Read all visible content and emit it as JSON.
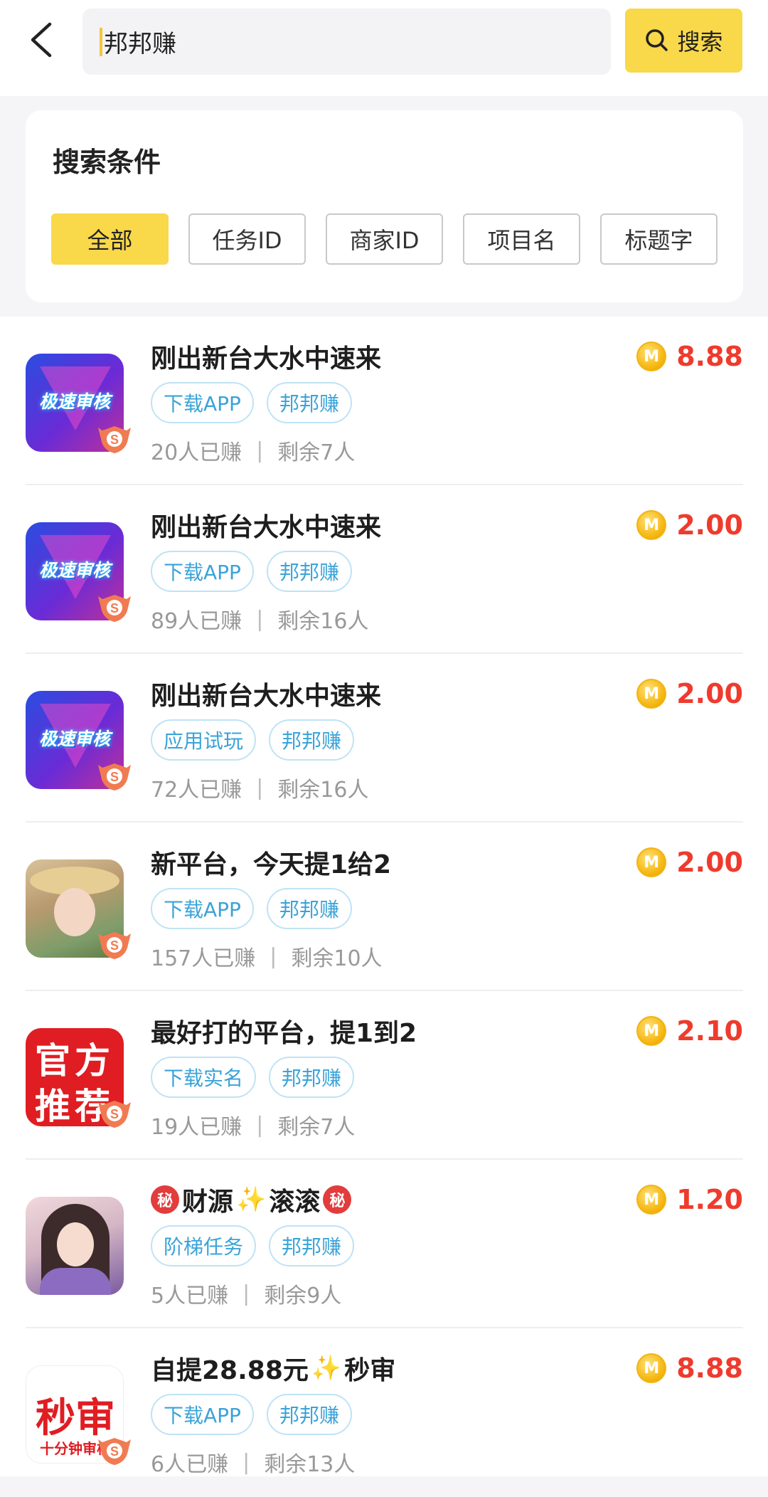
{
  "header": {
    "search_value": "邦邦赚",
    "search_button_label": "搜索"
  },
  "filter": {
    "title": "搜索条件",
    "chips": [
      {
        "label": "全部",
        "active": true
      },
      {
        "label": "任务ID",
        "active": false
      },
      {
        "label": "商家ID",
        "active": false
      },
      {
        "label": "项目名",
        "active": false
      },
      {
        "label": "标题字",
        "active": false
      }
    ]
  },
  "tasks": [
    {
      "thumb": "app-logo-jisu",
      "thumb_text": "极速审核",
      "title": "刚出新台大水中速来",
      "tags": [
        "下载APP",
        "邦邦赚"
      ],
      "earned": "20人已赚",
      "remaining": "剩余7人",
      "price": "8.88"
    },
    {
      "thumb": "app-logo-jisu",
      "thumb_text": "极速审核",
      "title": "刚出新台大水中速来",
      "tags": [
        "下载APP",
        "邦邦赚"
      ],
      "earned": "89人已赚",
      "remaining": "剩余16人",
      "price": "2.00"
    },
    {
      "thumb": "app-logo-jisu",
      "thumb_text": "极速审核",
      "title": "刚出新台大水中速来",
      "tags": [
        "应用试玩",
        "邦邦赚"
      ],
      "earned": "72人已赚",
      "remaining": "剩余16人",
      "price": "2.00"
    },
    {
      "thumb": "photo-girl-hat",
      "title": "新平台，今天提1给2",
      "tags": [
        "下载APP",
        "邦邦赚"
      ],
      "earned": "157人已赚",
      "remaining": "剩余10人",
      "price": "2.00"
    },
    {
      "thumb": "official-recommend",
      "thumb_text_top": "官方",
      "thumb_text_bottom": "推荐",
      "title": "最好打的平台，提1到2",
      "tags": [
        "下载实名",
        "邦邦赚"
      ],
      "earned": "19人已赚",
      "remaining": "剩余7人",
      "price": "2.10"
    },
    {
      "thumb": "photo-girl-purple",
      "title_parts": [
        "秘",
        "财源",
        "✨",
        "滚滚",
        "秘"
      ],
      "tags": [
        "阶梯任务",
        "邦邦赚"
      ],
      "earned": "5人已赚",
      "remaining": "剩余9人",
      "price": "1.20"
    },
    {
      "thumb": "miaoshen",
      "thumb_text_top": "秒审",
      "thumb_text_bottom": "十分钟审核",
      "title_parts": [
        "自提28.88元",
        "✨",
        "秒审"
      ],
      "tags": [
        "下载APP",
        "邦邦赚"
      ],
      "earned": "6人已赚",
      "remaining": "剩余13人",
      "price": "8.88"
    }
  ],
  "meta_separator": "|",
  "coin_letter": "M",
  "badge_letter": "S",
  "colors": {
    "accent": "#f9d84a",
    "price": "#ee3b2d",
    "tag": "#3aa3d8"
  }
}
